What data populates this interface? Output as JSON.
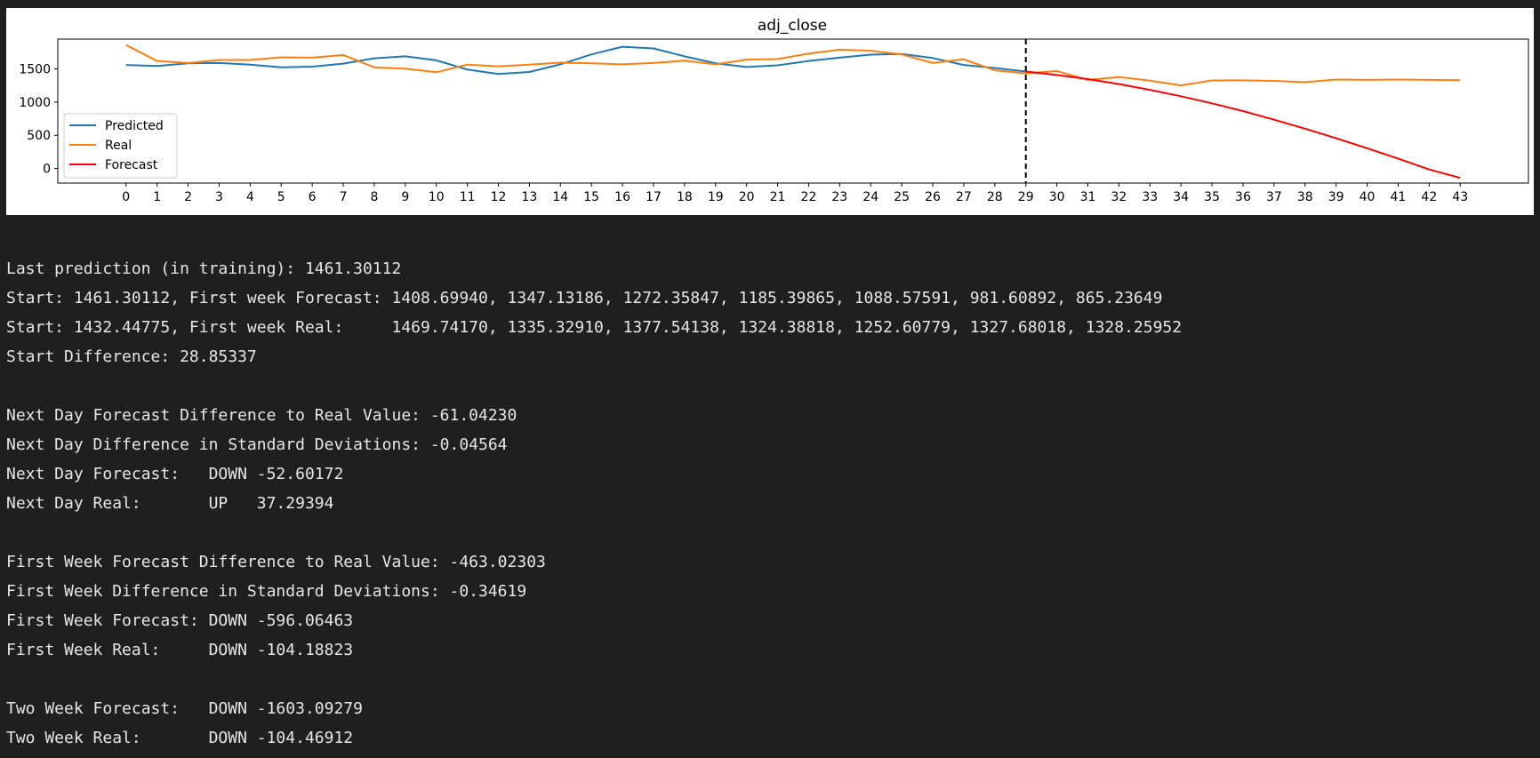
{
  "chart_data": {
    "type": "line",
    "title": "adj_close",
    "xlabel": "",
    "ylabel": "",
    "xlim": [
      -2.2,
      45.2
    ],
    "ylim": [
      -220,
      1950
    ],
    "xticks": [
      0,
      1,
      2,
      3,
      4,
      5,
      6,
      7,
      8,
      9,
      10,
      11,
      12,
      13,
      14,
      15,
      16,
      17,
      18,
      19,
      20,
      21,
      22,
      23,
      24,
      25,
      26,
      27,
      28,
      29,
      30,
      31,
      32,
      33,
      34,
      35,
      36,
      37,
      38,
      39,
      40,
      41,
      42,
      43
    ],
    "yticks": [
      0,
      500,
      1000,
      1500
    ],
    "vline": {
      "x": 29,
      "style": "dashed",
      "color": "#000000"
    },
    "legend": {
      "position": "lower-left"
    },
    "grid": false,
    "series": [
      {
        "name": "Predicted",
        "color": "#1f77b4",
        "x": [
          0,
          1,
          2,
          3,
          4,
          5,
          6,
          7,
          8,
          9,
          10,
          11,
          12,
          13,
          14,
          15,
          16,
          17,
          18,
          19,
          20,
          21,
          22,
          23,
          24,
          25,
          26,
          27,
          28,
          29
        ],
        "y": [
          1560,
          1545,
          1585,
          1590,
          1565,
          1525,
          1535,
          1580,
          1660,
          1690,
          1630,
          1490,
          1425,
          1455,
          1570,
          1720,
          1835,
          1810,
          1690,
          1585,
          1530,
          1555,
          1620,
          1670,
          1715,
          1725,
          1665,
          1560,
          1515,
          1461.30112
        ]
      },
      {
        "name": "Real",
        "color": "#ff7f0e",
        "x": [
          0,
          1,
          2,
          3,
          4,
          5,
          6,
          7,
          8,
          9,
          10,
          11,
          12,
          13,
          14,
          15,
          16,
          17,
          18,
          19,
          20,
          21,
          22,
          23,
          24,
          25,
          26,
          27,
          28,
          29,
          30,
          31,
          32,
          33,
          34,
          35,
          36,
          37,
          38,
          39,
          40,
          41,
          42,
          43
        ],
        "y": [
          1860,
          1620,
          1590,
          1635,
          1635,
          1675,
          1670,
          1710,
          1525,
          1505,
          1450,
          1565,
          1540,
          1565,
          1595,
          1585,
          1570,
          1590,
          1625,
          1570,
          1640,
          1650,
          1730,
          1790,
          1775,
          1720,
          1590,
          1645,
          1480,
          1432.44775,
          1469.7417,
          1335.3291,
          1377.54138,
          1324.38818,
          1252.60779,
          1327.68018,
          1328.25952,
          1320,
          1300,
          1340,
          1335,
          1340,
          1335,
          1330
        ]
      },
      {
        "name": "Forecast",
        "color": "#ff0000",
        "x": [
          29,
          30,
          31,
          32,
          33,
          34,
          35,
          36,
          37,
          38,
          39,
          40,
          41,
          42,
          43
        ],
        "y": [
          1461.30112,
          1408.6994,
          1347.13186,
          1272.35847,
          1185.39865,
          1088.57591,
          981.60892,
          865.23649,
          735,
          600,
          455,
          305,
          150,
          -15,
          -142
        ]
      }
    ]
  },
  "output_lines": [
    "Last prediction (in training): 1461.30112",
    "Start: 1461.30112, First week Forecast: 1408.69940, 1347.13186, 1272.35847, 1185.39865, 1088.57591, 981.60892, 865.23649",
    "Start: 1432.44775, First week Real:     1469.74170, 1335.32910, 1377.54138, 1324.38818, 1252.60779, 1327.68018, 1328.25952",
    "Start Difference: 28.85337",
    "",
    "Next Day Forecast Difference to Real Value: -61.04230",
    "Next Day Difference in Standard Deviations: -0.04564",
    "Next Day Forecast:   DOWN -52.60172",
    "Next Day Real:       UP   37.29394",
    "",
    "First Week Forecast Difference to Real Value: -463.02303",
    "First Week Difference in Standard Deviations: -0.34619",
    "First Week Forecast: DOWN -596.06463",
    "First Week Real:     DOWN -104.18823",
    "",
    "Two Week Forecast:   DOWN -1603.09279",
    "Two Week Real:       DOWN -104.46912"
  ]
}
